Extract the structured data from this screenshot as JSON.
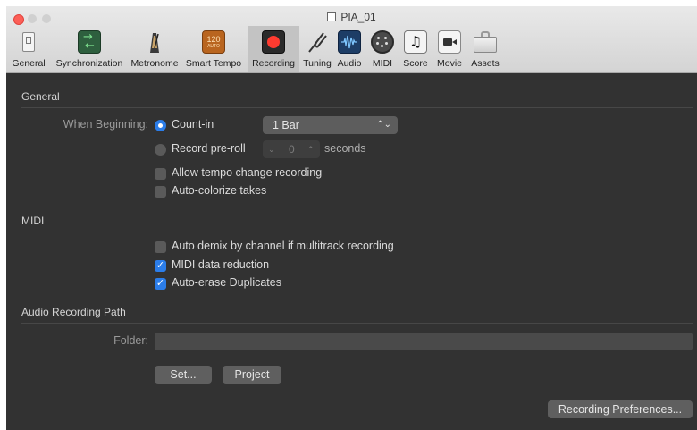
{
  "window": {
    "title": "PIA_01"
  },
  "toolbar": {
    "tabs": [
      {
        "label": "General",
        "icon": "switch-icon"
      },
      {
        "label": "Synchronization",
        "icon": "sync-arrows-icon"
      },
      {
        "label": "Metronome",
        "icon": "metronome-icon"
      },
      {
        "label": "Smart Tempo",
        "icon": "smart-tempo-icon",
        "icon_text": "120",
        "icon_subtext": "AUTO"
      },
      {
        "label": "Recording",
        "icon": "record-icon",
        "active": true
      },
      {
        "label": "Tuning",
        "icon": "tuning-fork-icon"
      },
      {
        "label": "Audio",
        "icon": "waveform-icon"
      },
      {
        "label": "MIDI",
        "icon": "midi-port-icon"
      },
      {
        "label": "Score",
        "icon": "music-note-icon",
        "icon_text": "♫"
      },
      {
        "label": "Movie",
        "icon": "movie-camera-icon"
      },
      {
        "label": "Assets",
        "icon": "briefcase-icon"
      }
    ]
  },
  "general": {
    "heading": "General",
    "when_beginning_label": "When Beginning:",
    "count_in": {
      "label": "Count-in",
      "selected": true,
      "value": "1 Bar"
    },
    "record_preroll": {
      "label": "Record pre-roll",
      "selected": false,
      "value": "0",
      "unit": "seconds"
    },
    "allow_tempo": {
      "label": "Allow tempo change recording",
      "checked": false
    },
    "auto_colorize": {
      "label": "Auto-colorize takes",
      "checked": false
    }
  },
  "midi": {
    "heading": "MIDI",
    "auto_demix": {
      "label": "Auto demix by channel if multitrack recording",
      "checked": false
    },
    "data_reduction": {
      "label": "MIDI data reduction",
      "checked": true
    },
    "auto_erase": {
      "label": "Auto-erase Duplicates",
      "checked": true
    }
  },
  "audio_path": {
    "heading": "Audio Recording Path",
    "folder_label": "Folder:",
    "folder_value": "",
    "set_button": "Set...",
    "project_button": "Project"
  },
  "footer": {
    "preferences_button": "Recording Preferences..."
  },
  "colors": {
    "accent": "#2b7de9",
    "record": "#ff3b30",
    "background": "#323232"
  }
}
